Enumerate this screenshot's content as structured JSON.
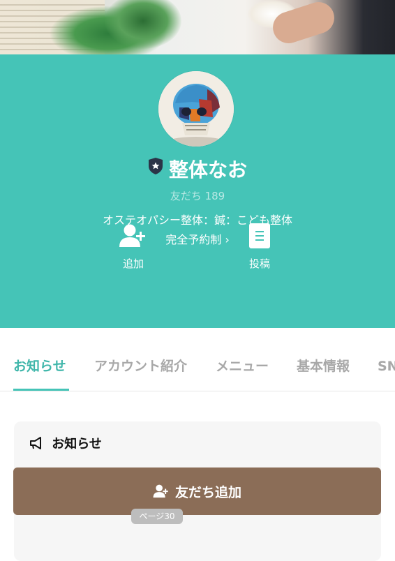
{
  "profile": {
    "name": "整体なお",
    "friends_label": "友だち",
    "friends_count": "189",
    "tagline": "オステオパシー整体：鍼：こども整体",
    "reservation": "完全予約制 ›"
  },
  "actions": [
    {
      "label": "追加",
      "icon": "add-friend-icon"
    },
    {
      "label": "投稿",
      "icon": "post-icon"
    }
  ],
  "tabs": [
    {
      "label": "お知らせ",
      "active": true
    },
    {
      "label": "アカウント紹介",
      "active": false
    },
    {
      "label": "メニュー",
      "active": false
    },
    {
      "label": "基本情報",
      "active": false
    },
    {
      "label": "SN",
      "active": false
    }
  ],
  "notice": {
    "title": "お知らせ",
    "icon": "megaphone-icon"
  },
  "cta": {
    "label": "友だち追加",
    "icon": "add-friend-icon"
  },
  "page_tip": "ページ30",
  "colors": {
    "header": "#45c4b7",
    "cta": "#8b6d57",
    "tab_active": "#3fb6aa",
    "tab_inactive": "#a8a8a8"
  }
}
